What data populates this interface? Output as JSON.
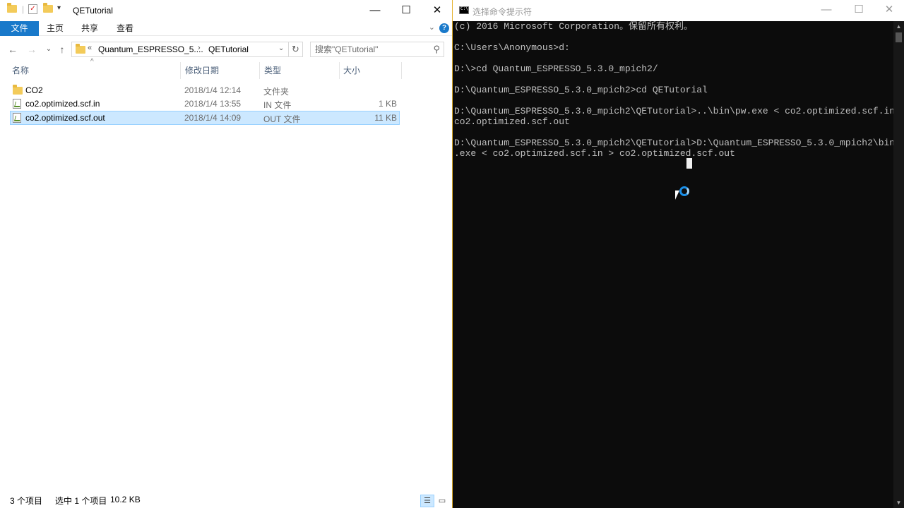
{
  "explorer": {
    "title": "QETutorial",
    "window_buttons": {
      "minimize": "—",
      "maximize": "☐",
      "close": "✕"
    },
    "ribbon": {
      "tabs": [
        "文件",
        "主页",
        "共享",
        "查看"
      ],
      "help": "?"
    },
    "address": {
      "overflow": "«",
      "crumbs": [
        "Quantum_ESPRESSO_5....",
        "QETutorial"
      ],
      "separator": "›"
    },
    "search": {
      "placeholder": "搜索\"QETutorial\""
    },
    "columns": {
      "name": "名称",
      "date": "修改日期",
      "type": "类型",
      "size": "大小"
    },
    "files": [
      {
        "name": "CO2",
        "date": "2018/1/4 12:14",
        "type": "文件夹",
        "size": "",
        "kind": "folder"
      },
      {
        "name": "co2.optimized.scf.in",
        "date": "2018/1/4 13:55",
        "type": "IN 文件",
        "size": "1 KB",
        "kind": "file"
      },
      {
        "name": "co2.optimized.scf.out",
        "date": "2018/1/4 14:09",
        "type": "OUT 文件",
        "size": "11 KB",
        "kind": "file",
        "selected": true
      }
    ],
    "status": {
      "item_count": "3 个项目",
      "selection": "选中 1 个项目",
      "selection_size": "10.2 KB"
    }
  },
  "console": {
    "title": "选择命令提示符",
    "window_buttons": {
      "minimize": "—",
      "maximize": "☐",
      "close": "✕"
    },
    "lines": [
      "(c) 2016 Microsoft Corporation。保留所有权利。",
      "",
      "C:\\Users\\Anonymous>d:",
      "",
      "D:\\>cd Quantum_ESPRESSO_5.3.0_mpich2/",
      "",
      "D:\\Quantum_ESPRESSO_5.3.0_mpich2>cd QETutorial",
      "",
      "D:\\Quantum_ESPRESSO_5.3.0_mpich2\\QETutorial>..\\bin\\pw.exe < co2.optimized.scf.in >",
      "co2.optimized.scf.out",
      "",
      "D:\\Quantum_ESPRESSO_5.3.0_mpich2\\QETutorial>D:\\Quantum_ESPRESSO_5.3.0_mpich2\\bin\\pw",
      ".exe < co2.optimized.scf.in > co2.optimized.scf.out"
    ]
  },
  "colors": {
    "ribbon_file_tab": "#1979ca",
    "selection_bg": "#cce8ff",
    "selection_border": "#99d1ff",
    "console_bg": "#0c0c0c",
    "console_text": "#c0c0c0",
    "busy_cursor": "#1a8fe8"
  }
}
